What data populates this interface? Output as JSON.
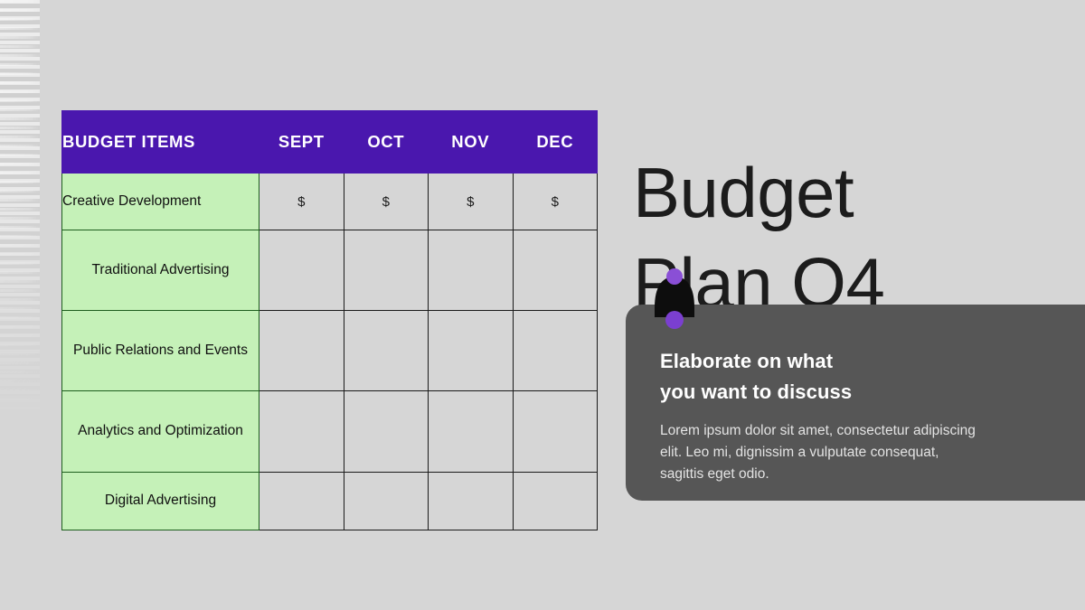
{
  "title": "Budget\nPlan Q4",
  "table": {
    "headers": [
      "BUDGET ITEMS",
      "SEPT",
      "OCT",
      "NOV",
      "DEC"
    ],
    "rows": [
      {
        "label": "Creative Development",
        "align": "left",
        "values": [
          "$",
          "$",
          "$",
          "$"
        ]
      },
      {
        "label": "Traditional\nAdvertising",
        "align": "center",
        "values": [
          "",
          "",
          "",
          ""
        ]
      },
      {
        "label": "Public Relations\nand Events",
        "align": "center",
        "values": [
          "",
          "",
          "",
          ""
        ]
      },
      {
        "label": "Analytics and\nOptimization",
        "align": "center",
        "values": [
          "",
          "",
          "",
          ""
        ]
      },
      {
        "label": "Digital Advertising",
        "align": "center",
        "values": [
          "",
          "",
          "",
          ""
        ]
      }
    ]
  },
  "note_card": {
    "heading": "Elaborate on what\nyou want to discuss",
    "body": "Lorem ipsum dolor sit amet, consectetur adipiscing elit. Leo mi, dignissim a vulputate consequat, sagittis eget odio."
  },
  "icons": {
    "bell": "bell-icon"
  },
  "colors": {
    "background": "#d6d6d6",
    "header_purple": "#4a17ae",
    "row_green": "#c5f1b8",
    "green_border": "#1e5e1e",
    "card_gray": "#565656",
    "accent_purple": "#8a4fd6",
    "bell_black": "#0d0d0d",
    "text_dark": "#1c1c1c"
  }
}
